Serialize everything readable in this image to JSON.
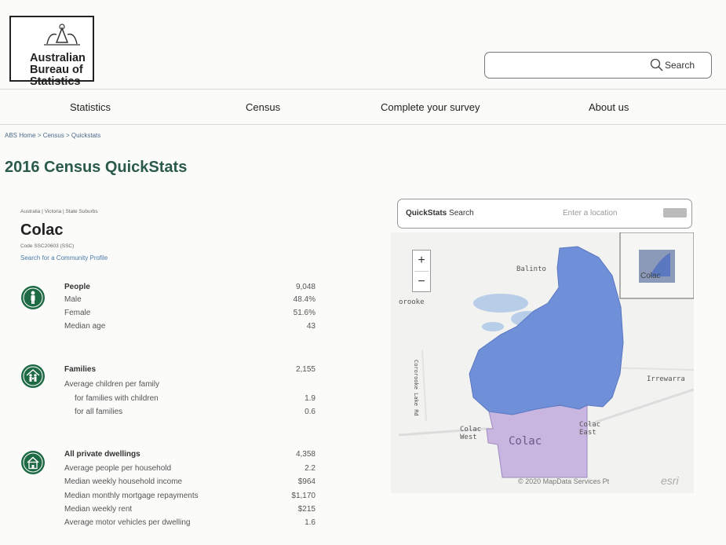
{
  "header": {
    "logo_lines": [
      "Australian",
      "Bureau of",
      "Statistics"
    ],
    "search_label": "Search"
  },
  "nav": [
    "Statistics",
    "Census",
    "Complete your survey",
    "About us"
  ],
  "breadcrumb": "ABS Home > Census > Quickstats",
  "page_title": "2016 Census QuickStats",
  "location": {
    "crumb": "Australia | Victoria | State Suburbs",
    "name": "Colac",
    "code": "Code SSC20603 (SSC)",
    "community_link": "Search for a Community Profile"
  },
  "stats": {
    "people": [
      {
        "label": "People",
        "value": "9,048"
      },
      {
        "label": "Male",
        "value": "48.4%"
      },
      {
        "label": "Female",
        "value": "51.6%"
      },
      {
        "label": "Median age",
        "value": "43"
      }
    ],
    "families": [
      {
        "label": "Families",
        "value": "2,155"
      },
      {
        "label": "Average children per family",
        "value": ""
      },
      {
        "label": "for families with children",
        "value": "1.9"
      },
      {
        "label": "for all families",
        "value": "0.6"
      }
    ],
    "dwellings": [
      {
        "label": "All private dwellings",
        "value": "4,358"
      },
      {
        "label": "Average people per household",
        "value": "2.2"
      },
      {
        "label": "Median weekly household income",
        "value": "$964"
      },
      {
        "label": "Median monthly mortgage repayments",
        "value": "$1,170"
      },
      {
        "label": "Median weekly rent",
        "value": "$215"
      },
      {
        "label": "Average motor vehicles per dwelling",
        "value": "1.6"
      }
    ]
  },
  "map": {
    "search_title_bold": "QuickStats",
    "search_title_rest": " Search",
    "search_placeholder": "Enter a location",
    "zoom_in": "+",
    "zoom_out": "−",
    "labels": {
      "balintore": "Balinto",
      "elingamite": "orooke",
      "irrewarra": "Irrewarra",
      "colac_west": "Colac\nWest",
      "colac_east": "Colac\nEast",
      "colac": "Colac",
      "road": "Cororooke Lake Rd",
      "attribution": "© 2020 MapData Services Pt",
      "esri": "esri",
      "inset": "Colac"
    },
    "colors": {
      "region": "#6f8fd8",
      "region_lower": "#c8b6e0",
      "lake": "#b8cde8"
    }
  }
}
